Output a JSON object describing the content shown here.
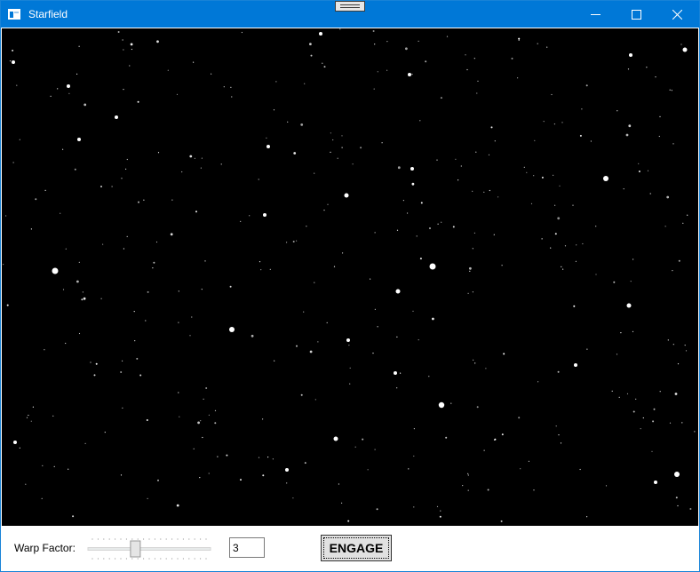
{
  "window": {
    "title": "Starfield",
    "icons": {
      "app": "window-app-icon",
      "minimize": "minimize-icon",
      "maximize": "maximize-icon",
      "close": "close-icon"
    },
    "titlebar_color": "#0078d7"
  },
  "starfield": {
    "background": "#000000",
    "star_color": "#ffffff"
  },
  "controls": {
    "warp_label": "Warp Factor:",
    "slider_value": 3,
    "slider_max": 10,
    "input_value": "3",
    "engage_label": "ENGAGE"
  }
}
